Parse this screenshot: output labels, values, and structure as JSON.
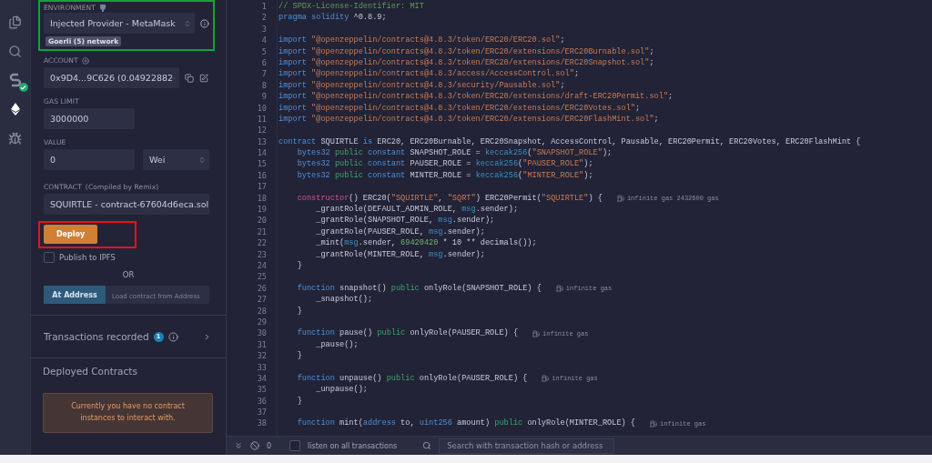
{
  "icon_bar": [
    {
      "selected": false
    },
    {
      "selected": false
    },
    {
      "selected": false
    },
    {
      "selected": true
    },
    {
      "selected": false
    }
  ],
  "environment": {
    "label": "ENVIRONMENT",
    "value": "Injected Provider - MetaMask",
    "network": "Goerli (5) network"
  },
  "account": {
    "label": "ACCOUNT",
    "value": "0x9D4...9C626 (0.04922882"
  },
  "gas_limit": {
    "label": "GAS LIMIT",
    "value": "3000000"
  },
  "value": {
    "label": "VALUE",
    "amount": "0",
    "unit": "Wei"
  },
  "contract": {
    "label": "CONTRACT",
    "hint": "(Compiled by Remix)",
    "value": "SQUIRTLE - contract-67604d6eca.sol"
  },
  "deploy_button": "Deploy",
  "publish": {
    "label": "Publish to IPFS",
    "checked": false
  },
  "or_label": "OR",
  "at_address": {
    "button": "At Address",
    "placeholder": "Load contract from Address"
  },
  "transactions": {
    "label": "Transactions recorded",
    "count": "1"
  },
  "deployed": {
    "title": "Deployed Contracts",
    "message": "Currently you have no contract instances to interact with."
  },
  "editor": {
    "lines": [
      {
        "no": "1",
        "code": [
          {
            "kind": "comment",
            "text": "// SPDX-License-Identifier: MIT"
          }
        ]
      },
      {
        "no": "2",
        "code": [
          {
            "kind": "kw",
            "text": "pragma solidity"
          },
          {
            "kind": "plain",
            "text": " ^0.8.9;"
          }
        ]
      },
      {
        "no": "3"
      },
      {
        "no": "4",
        "code": [
          {
            "kind": "kw",
            "text": "import"
          },
          {
            "kind": "str",
            "text": " \"@openzeppelin/contracts@4.8.3/token/ERC20/ERC20.sol\""
          },
          {
            "kind": "plain",
            "text": ";"
          }
        ]
      },
      {
        "no": "5",
        "code": [
          {
            "kind": "kw",
            "text": "import"
          },
          {
            "kind": "str",
            "text": " \"@openzeppelin/contracts@4.8.3/token/ERC20/extensions/ERC20Burnable.sol\""
          },
          {
            "kind": "plain",
            "text": ";"
          }
        ]
      },
      {
        "no": "6",
        "code": [
          {
            "kind": "kw",
            "text": "import"
          },
          {
            "kind": "str",
            "text": " \"@openzeppelin/contracts@4.8.3/token/ERC20/extensions/ERC20Snapshot.sol\""
          },
          {
            "kind": "plain",
            "text": ";"
          }
        ]
      },
      {
        "no": "7",
        "code": [
          {
            "kind": "kw",
            "text": "import"
          },
          {
            "kind": "str",
            "text": " \"@openzeppelin/contracts@4.8.3/access/AccessControl.sol\""
          },
          {
            "kind": "plain",
            "text": ";"
          }
        ]
      },
      {
        "no": "8",
        "code": [
          {
            "kind": "kw",
            "text": "import"
          },
          {
            "kind": "str",
            "text": " \"@openzeppelin/contracts@4.8.3/security/Pausable.sol\""
          },
          {
            "kind": "plain",
            "text": ";"
          }
        ]
      },
      {
        "no": "9",
        "code": [
          {
            "kind": "kw",
            "text": "import"
          },
          {
            "kind": "str",
            "text": " \"@openzeppelin/contracts@4.8.3/token/ERC20/extensions/draft-ERC20Permit.sol\""
          },
          {
            "kind": "plain",
            "text": ";"
          }
        ]
      },
      {
        "no": "10",
        "code": [
          {
            "kind": "kw",
            "text": "import"
          },
          {
            "kind": "str",
            "text": " \"@openzeppelin/contracts@4.8.3/token/ERC20/extensions/ERC20Votes.sol\""
          },
          {
            "kind": "plain",
            "text": ";"
          }
        ]
      },
      {
        "no": "11",
        "code": [
          {
            "kind": "kw",
            "text": "import"
          },
          {
            "kind": "str",
            "text": " \"@openzeppelin/contracts@4.8.3/token/ERC20/extensions/ERC20FlashMint.sol\""
          },
          {
            "kind": "plain",
            "text": ";"
          }
        ]
      },
      {
        "no": "12"
      },
      {
        "no": "13",
        "code": [
          {
            "kind": "kw",
            "text": "contract"
          },
          {
            "kind": "plain",
            "text": " SQUIRTLE "
          },
          {
            "kind": "kw",
            "text": "is"
          },
          {
            "kind": "plain",
            "text": " ERC20, ERC20Burnable, ERC20Snapshot, AccessControl, Pausable, ERC20Permit, ERC20Votes, ERC20FlashMint {"
          }
        ]
      },
      {
        "no": "14",
        "code": [
          {
            "kind": "kw",
            "text": "    bytes32"
          },
          {
            "kind": "mod",
            "text": " public"
          },
          {
            "kind": "kw",
            "text": " constant"
          },
          {
            "kind": "plain",
            "text": " SNAPSHOT_ROLE = "
          },
          {
            "kind": "call",
            "text": "keccak256"
          },
          {
            "kind": "plain",
            "text": "("
          },
          {
            "kind": "str",
            "text": "\"SNAPSHOT_ROLE\""
          },
          {
            "kind": "plain",
            "text": ");"
          }
        ]
      },
      {
        "no": "15",
        "code": [
          {
            "kind": "kw",
            "text": "    bytes32"
          },
          {
            "kind": "mod",
            "text": " public"
          },
          {
            "kind": "kw",
            "text": " constant"
          },
          {
            "kind": "plain",
            "text": " PAUSER_ROLE = "
          },
          {
            "kind": "call",
            "text": "keccak256"
          },
          {
            "kind": "plain",
            "text": "("
          },
          {
            "kind": "str",
            "text": "\"PAUSER_ROLE\""
          },
          {
            "kind": "plain",
            "text": ");"
          }
        ]
      },
      {
        "no": "16",
        "code": [
          {
            "kind": "kw",
            "text": "    bytes32"
          },
          {
            "kind": "mod",
            "text": " public"
          },
          {
            "kind": "kw",
            "text": " constant"
          },
          {
            "kind": "plain",
            "text": " MINTER_ROLE = "
          },
          {
            "kind": "call",
            "text": "keccak256"
          },
          {
            "kind": "plain",
            "text": "("
          },
          {
            "kind": "str",
            "text": "\"MINTER_ROLE\""
          },
          {
            "kind": "plain",
            "text": ");"
          }
        ]
      },
      {
        "no": "17"
      },
      {
        "no": "18",
        "code": [
          {
            "kind": "ctor",
            "text": "    constructor"
          },
          {
            "kind": "plain",
            "text": "() ERC20("
          },
          {
            "kind": "str",
            "text": "\"SQUIRTLE\""
          },
          {
            "kind": "plain",
            "text": ", "
          },
          {
            "kind": "str",
            "text": "\"SQRT\""
          },
          {
            "kind": "plain",
            "text": ") ERC20Permit("
          },
          {
            "kind": "str",
            "text": "\"SQUIRTLE\""
          },
          {
            "kind": "plain",
            "text": ") {"
          }
        ],
        "gas": "infinite gas 2432600 gas"
      },
      {
        "no": "19",
        "code": [
          {
            "kind": "plain",
            "text": "        _grantRole(DEFAULT_ADMIN_ROLE, "
          },
          {
            "kind": "call",
            "text": "msg"
          },
          {
            "kind": "plain",
            "text": ".sender);"
          }
        ]
      },
      {
        "no": "20",
        "code": [
          {
            "kind": "plain",
            "text": "        _grantRole(SNAPSHOT_ROLE, "
          },
          {
            "kind": "call",
            "text": "msg"
          },
          {
            "kind": "plain",
            "text": ".sender);"
          }
        ]
      },
      {
        "no": "21",
        "code": [
          {
            "kind": "plain",
            "text": "        _grantRole(PAUSER_ROLE, "
          },
          {
            "kind": "call",
            "text": "msg"
          },
          {
            "kind": "plain",
            "text": ".sender);"
          }
        ]
      },
      {
        "no": "22",
        "code": [
          {
            "kind": "plain",
            "text": "        _mint("
          },
          {
            "kind": "call",
            "text": "msg"
          },
          {
            "kind": "plain",
            "text": ".sender, "
          },
          {
            "kind": "num",
            "text": "69420420"
          },
          {
            "kind": "plain",
            "text": " * 10 ** decimals());"
          }
        ]
      },
      {
        "no": "23",
        "code": [
          {
            "kind": "plain",
            "text": "        _grantRole(MINTER_ROLE, "
          },
          {
            "kind": "call",
            "text": "msg"
          },
          {
            "kind": "plain",
            "text": ".sender);"
          }
        ]
      },
      {
        "no": "24",
        "code": [
          {
            "kind": "plain",
            "text": "    }"
          }
        ]
      },
      {
        "no": "25"
      },
      {
        "no": "26",
        "code": [
          {
            "kind": "kw",
            "text": "    function"
          },
          {
            "kind": "plain",
            "text": " snapshot() "
          },
          {
            "kind": "mod",
            "text": "public"
          },
          {
            "kind": "plain",
            "text": " onlyRole(SNAPSHOT_ROLE) {"
          }
        ],
        "gas": "infinite gas"
      },
      {
        "no": "27",
        "code": [
          {
            "kind": "plain",
            "text": "        _snapshot();"
          }
        ]
      },
      {
        "no": "28",
        "code": [
          {
            "kind": "plain",
            "text": "    }"
          }
        ]
      },
      {
        "no": "29"
      },
      {
        "no": "30",
        "code": [
          {
            "kind": "kw",
            "text": "    function"
          },
          {
            "kind": "plain",
            "text": " pause() "
          },
          {
            "kind": "mod",
            "text": "public"
          },
          {
            "kind": "plain",
            "text": " onlyRole(PAUSER_ROLE) {"
          }
        ],
        "gas": "infinite gas"
      },
      {
        "no": "31",
        "code": [
          {
            "kind": "plain",
            "text": "        _pause();"
          }
        ]
      },
      {
        "no": "32",
        "code": [
          {
            "kind": "plain",
            "text": "    }"
          }
        ]
      },
      {
        "no": "33"
      },
      {
        "no": "34",
        "code": [
          {
            "kind": "kw",
            "text": "    function"
          },
          {
            "kind": "plain",
            "text": " unpause() "
          },
          {
            "kind": "mod",
            "text": "public"
          },
          {
            "kind": "plain",
            "text": " onlyRole(PAUSER_ROLE) {"
          }
        ],
        "gas": "infinite gas"
      },
      {
        "no": "35",
        "code": [
          {
            "kind": "plain",
            "text": "        _unpause();"
          }
        ]
      },
      {
        "no": "36",
        "code": [
          {
            "kind": "plain",
            "text": "    }"
          }
        ]
      },
      {
        "no": "37"
      },
      {
        "no": "38",
        "code": [
          {
            "kind": "kw",
            "text": "    function"
          },
          {
            "kind": "plain",
            "text": " mint("
          },
          {
            "kind": "kw",
            "text": "address"
          },
          {
            "kind": "plain",
            "text": " to, "
          },
          {
            "kind": "kw",
            "text": "uint256"
          },
          {
            "kind": "plain",
            "text": " amount) "
          },
          {
            "kind": "mod",
            "text": "public"
          },
          {
            "kind": "plain",
            "text": " onlyRole(MINTER_ROLE) {"
          }
        ],
        "gas": "infinite gas"
      }
    ]
  },
  "terminal": {
    "count": "0",
    "listen_label": "listen on all transactions",
    "listen_checked": false,
    "search_placeholder": "Search with transaction hash or address"
  }
}
